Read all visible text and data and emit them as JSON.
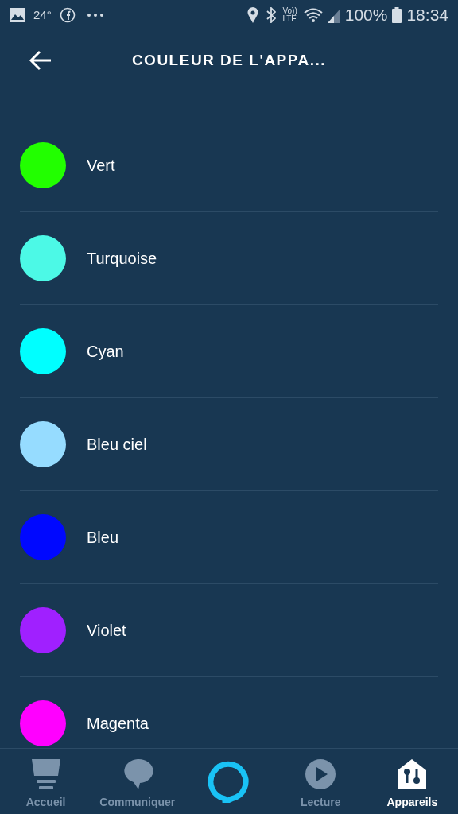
{
  "status_bar": {
    "temperature": "24°",
    "volte": [
      "Vo))",
      "LTE"
    ],
    "battery": "100%",
    "time": "18:34"
  },
  "header": {
    "title": "COULEUR DE L'APPA..."
  },
  "colors": [
    {
      "name": "Vert",
      "color": "#22ff00"
    },
    {
      "name": "Turquoise",
      "color": "#4cf9e6"
    },
    {
      "name": "Cyan",
      "color": "#00ffff"
    },
    {
      "name": "Bleu ciel",
      "color": "#96dcff"
    },
    {
      "name": "Bleu",
      "color": "#0008ff"
    },
    {
      "name": "Violet",
      "color": "#a020ff"
    },
    {
      "name": "Magenta",
      "color": "#ff00ff"
    }
  ],
  "nav": [
    {
      "kind": "home",
      "label": "Accueil",
      "selected": false
    },
    {
      "kind": "chat",
      "label": "Communiquer",
      "selected": false
    },
    {
      "kind": "alexa"
    },
    {
      "kind": "play",
      "label": "Lecture",
      "selected": false
    },
    {
      "kind": "devices",
      "label": "Appareils",
      "selected": true
    }
  ]
}
